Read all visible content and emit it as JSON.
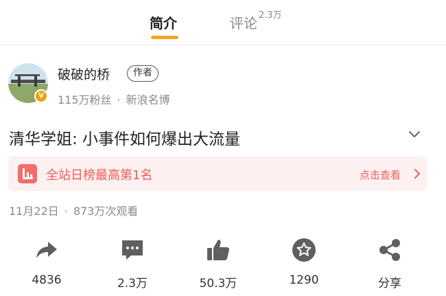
{
  "tabs": [
    {
      "label": "简介",
      "active": true
    },
    {
      "label": "评论",
      "count": "2.3万",
      "active": false
    }
  ],
  "author": {
    "name": "破破的桥",
    "badge": "作者",
    "followers": "115万粉丝",
    "separator": "·",
    "title": "新浪名博"
  },
  "video": {
    "title": "清华学姐: 小事件如何爆出大流量"
  },
  "ranking": {
    "text": "全站日榜最高第1名",
    "link": "点击查看"
  },
  "meta": {
    "date": "11月22日",
    "separator": "·",
    "views": "873万次观看"
  },
  "actions": [
    {
      "icon": "share-arrow-icon",
      "label": "4836"
    },
    {
      "icon": "comment-icon",
      "label": "2.3万"
    },
    {
      "icon": "thumbs-up-icon",
      "label": "50.3万"
    },
    {
      "icon": "star-icon",
      "label": "1290"
    },
    {
      "icon": "share-nodes-icon",
      "label": "分享"
    }
  ],
  "colors": {
    "accent": "#f5a623",
    "ranking_text": "#f25c5c",
    "ranking_bg": "#fdf0f0",
    "muted": "#8a8a8a",
    "icon_gray": "#5f5f5f"
  }
}
